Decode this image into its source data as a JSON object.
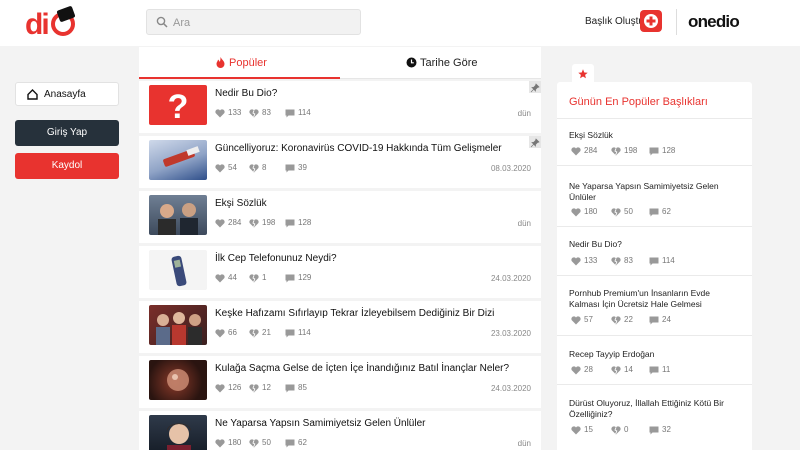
{
  "search": {
    "placeholder": "Ara"
  },
  "header": {
    "create_label": "Başlık Oluştur",
    "brand": "onedio"
  },
  "nav": {
    "home": "Anasayfa",
    "login": "Giriş Yap",
    "register": "Kaydol"
  },
  "tabs": [
    {
      "label": "Popüler",
      "active": true
    },
    {
      "label": "Tarihe Göre",
      "active": false
    }
  ],
  "feed": [
    {
      "title": "Nedir Bu Dio?",
      "likes": "133",
      "dislikes": "83",
      "comments": "114",
      "date": "dün",
      "pinned": true
    },
    {
      "title": "Güncelliyoruz: Koronavirüs COVID-19 Hakkında Tüm Gelişmeler",
      "likes": "54",
      "dislikes": "8",
      "comments": "39",
      "date": "08.03.2020",
      "pinned": true
    },
    {
      "title": "Ekşi Sözlük",
      "likes": "284",
      "dislikes": "198",
      "comments": "128",
      "date": "dün",
      "pinned": false
    },
    {
      "title": "İlk Cep Telefonunuz Neydi?",
      "likes": "44",
      "dislikes": "1",
      "comments": "129",
      "date": "24.03.2020",
      "pinned": false
    },
    {
      "title": "Keşke Hafızamı Sıfırlayıp Tekrar İzleyebilsem Dediğiniz Bir Dizi",
      "likes": "66",
      "dislikes": "21",
      "comments": "114",
      "date": "23.03.2020",
      "pinned": false
    },
    {
      "title": "Kulağa Saçma Gelse de İçten İçe İnandığınız Batıl İnançlar Neler?",
      "likes": "126",
      "dislikes": "12",
      "comments": "85",
      "date": "24.03.2020",
      "pinned": false
    },
    {
      "title": "Ne Yaparsa Yapsın Samimiyetsiz Gelen Ünlüler",
      "likes": "180",
      "dislikes": "50",
      "comments": "62",
      "date": "dün",
      "pinned": false
    }
  ],
  "popular": {
    "title": "Günün En Popüler Başlıkları",
    "items": [
      {
        "title": "Ekşi Sözlük",
        "likes": "284",
        "dislikes": "198",
        "comments": "128"
      },
      {
        "title": "Ne Yaparsa Yapsın Samimiyetsiz Gelen Ünlüler",
        "likes": "180",
        "dislikes": "50",
        "comments": "62"
      },
      {
        "title": "Nedir Bu Dio?",
        "likes": "133",
        "dislikes": "83",
        "comments": "114"
      },
      {
        "title": "Pornhub Premium'un İnsanların Evde Kalması İçin Ücretsiz Hale Gelmesi",
        "likes": "57",
        "dislikes": "22",
        "comments": "24"
      },
      {
        "title": "Recep Tayyip Erdoğan",
        "likes": "28",
        "dislikes": "14",
        "comments": "11"
      },
      {
        "title": "Dürüst Oluyoruz, İllallah Ettiğiniz Kötü Bir Özelliğiniz?",
        "likes": "15",
        "dislikes": "0",
        "comments": "32"
      }
    ]
  },
  "colors": {
    "accent": "#e8332f",
    "dark_button": "#26313b",
    "background": "#f3f3f3"
  }
}
